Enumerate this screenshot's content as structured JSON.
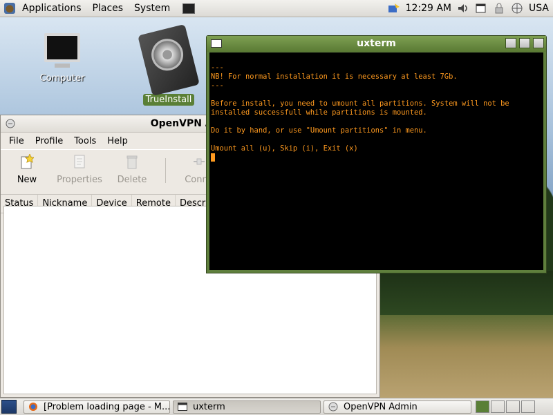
{
  "top_panel": {
    "menus": [
      "Applications",
      "Places",
      "System"
    ],
    "clock": "12:29 AM",
    "keyboard_layout": "USA"
  },
  "desktop": {
    "icons": [
      {
        "label": "Computer",
        "icon": "computer-icon"
      },
      {
        "label": "TrueInstall",
        "icon": "harddisk-icon"
      }
    ]
  },
  "openvpn": {
    "title": "OpenVPN Adm",
    "menu": [
      "File",
      "Profile",
      "Tools",
      "Help"
    ],
    "toolbar": [
      {
        "label": "New",
        "icon": "new-icon",
        "enabled": true
      },
      {
        "label": "Properties",
        "icon": "properties-icon",
        "enabled": false
      },
      {
        "label": "Delete",
        "icon": "delete-icon",
        "enabled": false
      },
      {
        "label": "Conne",
        "icon": "connect-icon",
        "enabled": false
      }
    ],
    "columns": [
      "Status",
      "Nickname",
      "Device",
      "Remote",
      "Descrip"
    ]
  },
  "uxterm": {
    "title": "uxterm",
    "lines": [
      "---",
      "NB! For normal installation it is necessary at least 7Gb.",
      "---",
      "",
      "Before install, you need to umount all partitions. System will not be",
      "installed successfull while partitions is mounted.",
      "",
      "Do it by hand, or use \"Umount partitions\" in menu.",
      "",
      "Umount all (u), Skip (i), Exit (x)"
    ]
  },
  "taskbar": {
    "tasks": [
      {
        "label": "[Problem loading page - M...",
        "icon": "firefox-icon",
        "active": false
      },
      {
        "label": "uxterm",
        "icon": "terminal-icon",
        "active": true
      },
      {
        "label": "OpenVPN Admin",
        "icon": "openvpn-icon",
        "active": false
      }
    ]
  },
  "colors": {
    "terminal_text": "#ff9a1f",
    "terminal_bg": "#000000",
    "titlebar_green": "#6a8d40"
  }
}
